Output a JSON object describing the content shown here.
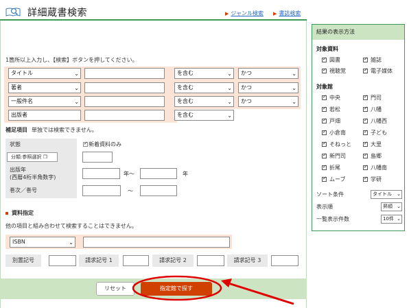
{
  "header": {
    "title": "詳細蔵書検索",
    "genre_link": "ジャンル検索",
    "holdings_link": "書誌検索"
  },
  "instruction": "1箇所以上入力し、【検索】ボタンを押してください。",
  "criteria": [
    {
      "field": "タイトル",
      "value": "",
      "match": "を含む",
      "op": "かつ"
    },
    {
      "field": "著者",
      "value": "",
      "match": "を含む",
      "op": "かつ"
    },
    {
      "field": "一般件名",
      "value": "",
      "match": "を含む",
      "op": "かつ"
    },
    {
      "field": "出版者",
      "value": "",
      "match": "を含む",
      "op": ""
    }
  ],
  "supplement": {
    "heading": "補足項目",
    "note": "単独では検索できません。",
    "status_label": "状態",
    "new_only_label": "新着資料のみ",
    "category_button": "分類:参照選択",
    "year_label_1": "出版年",
    "year_label_2": "(西暦4桁半角数字)",
    "year_from_suffix": "年〜",
    "year_to_suffix": "年",
    "volume_label": "巻次／巻号",
    "volume_sep": "〜"
  },
  "material": {
    "heading": "資料指定",
    "note": "他の項目と組み合わせて検索することはできません。",
    "id_type": "ISBN",
    "codes": [
      "別置記号",
      "請求記号 1",
      "請求記号 2",
      "請求記号 3"
    ]
  },
  "buttons": {
    "reset": "リセット",
    "search": "指定館で探す"
  },
  "sidebar": {
    "title": "結果の表示方法",
    "material_label": "対象資料",
    "materials": [
      "図書",
      "雑誌",
      "視聴覚",
      "電子媒体"
    ],
    "library_label": "対象館",
    "libraries": [
      "中央",
      "門司",
      "若松",
      "八幡",
      "戸畑",
      "八幡西",
      "小倉南",
      "子ども",
      "そねっと",
      "大里",
      "新門司",
      "島郷",
      "折尾",
      "八幡南",
      "ムーブ",
      "学研"
    ],
    "sort_label": "ソート条件",
    "sort_value": "タイトル",
    "order_label": "表示順",
    "order_value": "昇順",
    "count_label": "一覧表示件数",
    "count_value": "10件"
  },
  "colors": {
    "accent_green": "#3d9b5a",
    "panel_green": "#cde4c2",
    "row_pink": "#fbe3d6",
    "search_orange": "#d04000",
    "annotation_red": "#e00000"
  }
}
